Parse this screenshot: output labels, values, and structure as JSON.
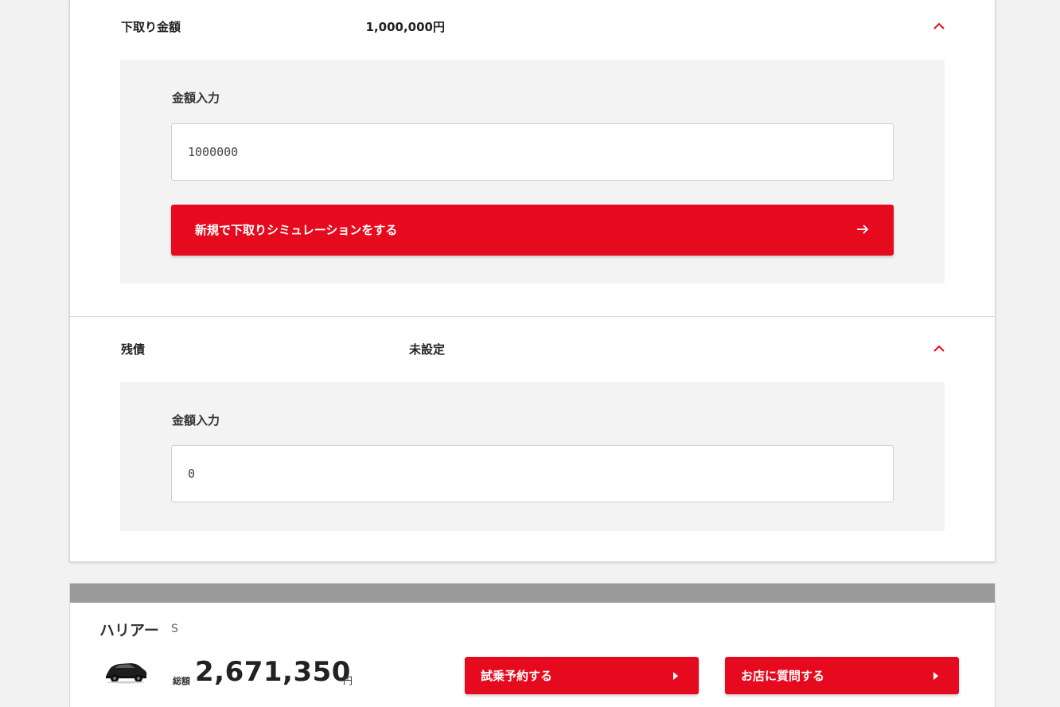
{
  "trade_in": {
    "label": "下取り金額",
    "value": "1,000,000円",
    "field_label": "金額入力",
    "input_value": "1000000",
    "button_label": "新規で下取りシミュレーションをする"
  },
  "residual": {
    "label": "残債",
    "value": "未設定",
    "field_label": "金額入力",
    "input_value": "0"
  },
  "summary": {
    "model_name": "ハリアー",
    "grade": "S",
    "total_label": "総額",
    "total_value": "2,671,350",
    "total_unit": "円",
    "test_drive_label": "試乗予約する",
    "ask_store_label": "お店に質問する"
  },
  "colors": {
    "accent": "#e60a1e",
    "panel_bg": "#f3f3f3",
    "page_bg": "#f2f2f2",
    "summary_bar": "#9a9a9a"
  },
  "icons": {
    "collapse": "chevron-up-icon",
    "arrow": "arrow-right-icon",
    "caret": "caret-right-icon",
    "car": "car-icon"
  }
}
